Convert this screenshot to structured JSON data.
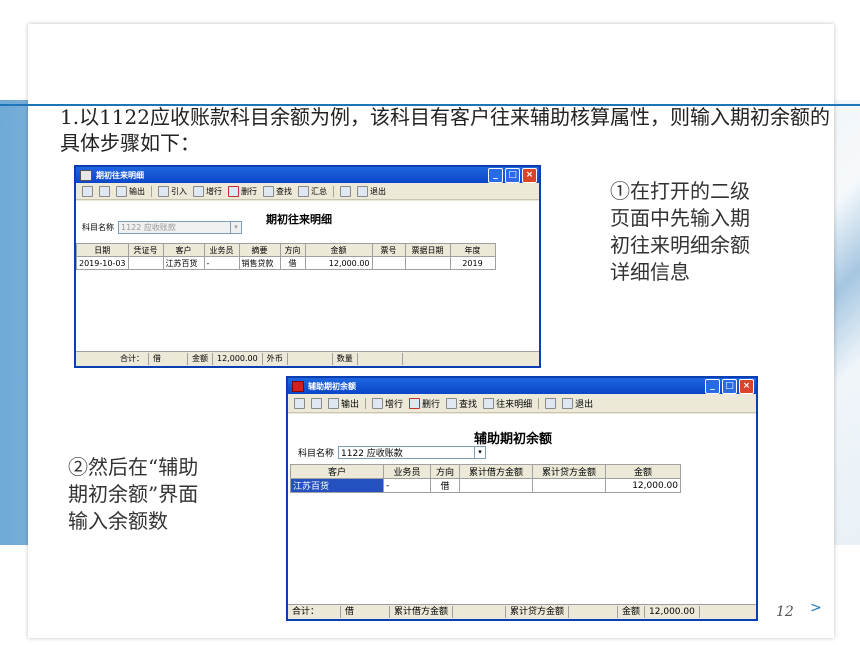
{
  "intro": "1.以1122应收账款科目余额为例，该科目有客户往来辅助核算属性，则输入期初余额的具体步骤如下：",
  "note1": [
    "①在打开的二级",
    "页面中先输入期",
    "初往来明细余额",
    "详细信息"
  ],
  "note2": [
    "②然后在“辅助",
    "期初余额”界面",
    "输入余额数"
  ],
  "page_number": "12",
  "next_symbol": ">",
  "win1": {
    "title": "期初往来明细",
    "toolbar": [
      "输出",
      "引入",
      "增行",
      "删行",
      "查找",
      "汇总",
      "退出"
    ],
    "form_title": "期初往来明细",
    "subject_label": "科目名称",
    "subject_value": "1122 应收账款",
    "columns": [
      "日期",
      "凭证号",
      "客户",
      "业务员",
      "摘要",
      "方向",
      "金额",
      "票号",
      "票据日期",
      "年度"
    ],
    "rows": [
      [
        "2019-10-03",
        "",
        "江苏百货",
        "-",
        "销售贷款",
        "借",
        "12,000.00",
        "",
        "",
        "2019"
      ]
    ],
    "status": [
      "合计：",
      "借",
      "金额",
      "12,000.00",
      "外币",
      "",
      "数量",
      ""
    ]
  },
  "win2": {
    "title": "辅助期初余额",
    "toolbar": [
      "输出",
      "增行",
      "删行",
      "查找",
      "往来明细",
      "退出"
    ],
    "form_title": "辅助期初余额",
    "subject_label": "科目名称",
    "subject_value": "1122 应收账款",
    "columns": [
      "客户",
      "业务员",
      "方向",
      "累计借方金额",
      "累计贷方金额",
      "金额"
    ],
    "rows": [
      [
        "江苏百货",
        "-",
        "借",
        "",
        "",
        "12,000.00"
      ]
    ],
    "status": [
      "合计：",
      "借",
      "累计借方金额",
      "",
      "累计贷方金额",
      "",
      "金额",
      "12,000.00"
    ]
  }
}
